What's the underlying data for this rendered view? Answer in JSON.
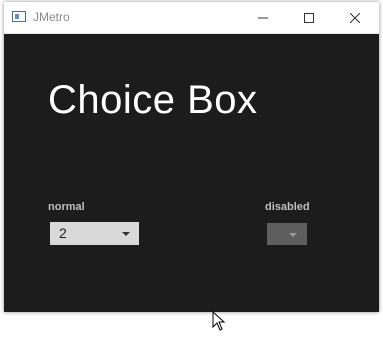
{
  "window": {
    "title": "JMetro",
    "app_icon": "window-icon",
    "controls": [
      "minimize-icon",
      "maximize-icon",
      "close-icon"
    ]
  },
  "main": {
    "heading": "Choice Box",
    "normal": {
      "label": "normal",
      "value": "2",
      "icon": "chevron-down-icon"
    },
    "disabled": {
      "label": "disabled",
      "value": "",
      "icon": "chevron-down-icon"
    }
  },
  "colors": {
    "background": "#1c1c1c",
    "titlebar": "#ffffff",
    "heading": "#ffffff",
    "label": "#bfbfbf",
    "choice_normal": "#d9d9d9",
    "choice_disabled": "#5e5e5e"
  }
}
